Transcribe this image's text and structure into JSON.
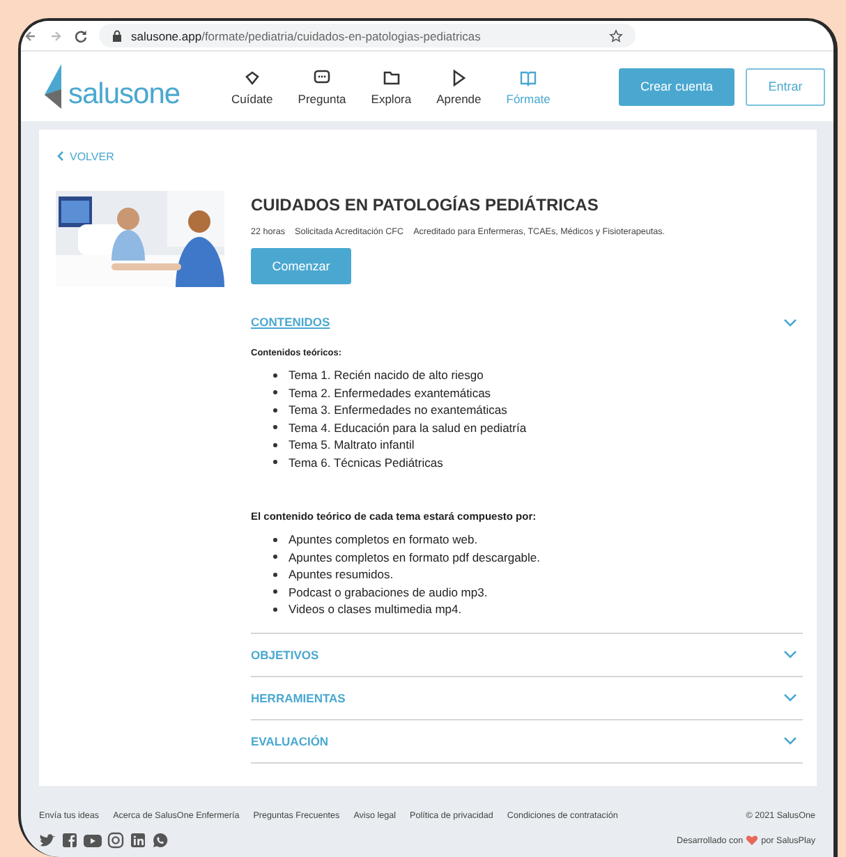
{
  "browser": {
    "url_host": "salusone.app",
    "url_path": "/formate/pediatria/cuidados-en-patologias-pediatricas"
  },
  "header": {
    "logo": "salusone",
    "nav": [
      {
        "label": "Cuídate",
        "selected": false
      },
      {
        "label": "Pregunta",
        "selected": false
      },
      {
        "label": "Explora",
        "selected": false
      },
      {
        "label": "Aprende",
        "selected": false
      },
      {
        "label": "Fórmate",
        "selected": true
      }
    ],
    "buttons": [
      {
        "label": "Crear cuenta",
        "kind": "primary"
      },
      {
        "label": "Entrar",
        "kind": "outline"
      }
    ]
  },
  "back_link": "VOLVER",
  "course": {
    "title": "CUIDADOS EN PATOLOGÍAS PEDIÁTRICAS",
    "meta": [
      "22 horas",
      "Solicitada Acreditación CFC",
      "Acreditado para Enfermeras, TCAEs, Médicos y Fisioterapeutas."
    ],
    "start_button": "Comenzar"
  },
  "sections": [
    {
      "title": "CONTENIDOS",
      "expanded": true,
      "blocks": [
        {
          "heading": "Contenidos teóricos:",
          "items": [
            "Tema 1. Recién nacido de alto riesgo",
            "Tema 2. Enfermedades exantemáticas",
            "Tema 3. Enfermedades no exantemáticas",
            "Tema 4. Educación para la salud en pediatría",
            "Tema 5. Maltrato infantil",
            "Tema 6. Técnicas Pediátricas"
          ]
        },
        {
          "heading": "El contenido teórico de cada tema estará compuesto por:",
          "items": [
            "Apuntes completos en formato web.",
            "Apuntes completos en formato pdf descargable.",
            "Apuntes resumidos.",
            "Podcast o grabaciones de audio mp3.",
            "Videos o clases multimedia mp4."
          ]
        }
      ]
    },
    {
      "title": "OBJETIVOS",
      "expanded": false
    },
    {
      "title": "HERRAMIENTAS",
      "expanded": false
    },
    {
      "title": "EVALUACIÓN",
      "expanded": false
    }
  ],
  "footer": {
    "links": [
      "Envía tus ideas",
      "Acerca de SalusOne Enfermería",
      "Preguntas Frecuentes",
      "Aviso legal",
      "Política de privacidad",
      "Condiciones de contratación"
    ],
    "copyright": "© 2021 SalusOne",
    "credit_before": "Desarrollado con",
    "credit_after": "por SalusPlay"
  }
}
